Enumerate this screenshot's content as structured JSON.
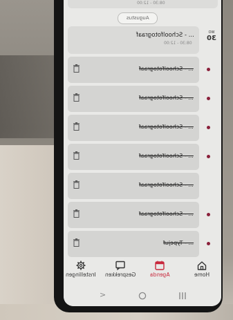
{
  "top_card": {
    "time": "08:30 - 12:00"
  },
  "month_label": "Augustus",
  "day": {
    "weekday": "WO",
    "number": "30"
  },
  "day_card": {
    "title": "... - Schoolfotograaf",
    "time": "08:30 - 12:00"
  },
  "items": [
    {
      "label": "... - Schoolfotograaf"
    },
    {
      "label": "... - Schoolfotograaf"
    },
    {
      "label": "... - Schoolfotograaf"
    },
    {
      "label": "... - Schoolfotograaf"
    },
    {
      "label": "... - Schoolfotograaf"
    },
    {
      "label": "... - Schoolfotograaf"
    },
    {
      "label": "... - Typejuf"
    }
  ],
  "nav": {
    "home": "Home",
    "agenda": "Agenda",
    "gesprekken": "Gesprekken",
    "instellingen": "Instellingen"
  },
  "colors": {
    "accent": "#c8283c",
    "dot": "#8a1f3a",
    "card": "#d4d4d2"
  }
}
